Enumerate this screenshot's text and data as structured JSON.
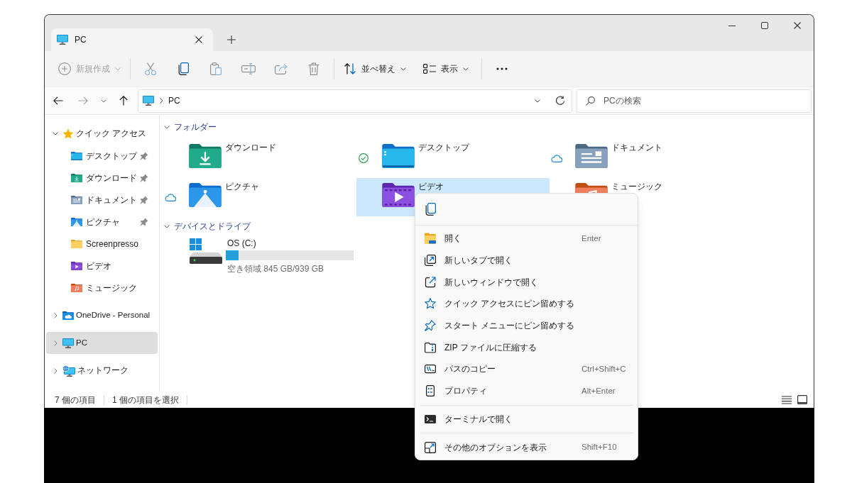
{
  "tabs": [
    {
      "label": "PC",
      "selected": true
    }
  ],
  "toolbar": {
    "new": {
      "label": "新規作成",
      "disabled": true
    },
    "actions": [
      {
        "kind": "cut",
        "disabled": true
      },
      {
        "kind": "copy",
        "disabled": false
      },
      {
        "kind": "paste",
        "disabled": true
      },
      {
        "kind": "rename",
        "disabled": true
      },
      {
        "kind": "share",
        "disabled": true
      },
      {
        "kind": "delete",
        "disabled": true
      }
    ],
    "sort": {
      "label": "並べ替え"
    },
    "view": {
      "label": "表示"
    }
  },
  "navigation": {
    "back": {
      "disabled": false
    },
    "forward": {
      "disabled": true
    },
    "up": {
      "disabled": false
    }
  },
  "address_bar": {
    "path": [
      {
        "kind": "pc",
        "label": "PC"
      }
    ]
  },
  "search": {
    "placeholder": "PCの検索"
  },
  "sidebar": {
    "items": [
      {
        "kind": "quickaccess",
        "label": "クイック アクセス",
        "expanded": true,
        "selected": false,
        "children": [
          {
            "kind": "desktop",
            "label": "デスクトップ",
            "pinned": true,
            "selected": false
          },
          {
            "kind": "downloads",
            "label": "ダウンロード",
            "pinned": true,
            "selected": false
          },
          {
            "kind": "documents",
            "label": "ドキュメント",
            "pinned": true,
            "selected": false
          },
          {
            "kind": "pictures",
            "label": "ピクチャ",
            "pinned": true,
            "selected": false
          },
          {
            "kind": "folder",
            "label": "Screenpresso",
            "pinned": false,
            "selected": false
          },
          {
            "kind": "videos",
            "label": "ビデオ",
            "pinned": false,
            "selected": false
          },
          {
            "kind": "music",
            "label": "ミュージック",
            "pinned": false,
            "selected": false
          }
        ]
      },
      {
        "kind": "onedrive",
        "label": "OneDrive - Personal",
        "expanded": false,
        "selected": false
      },
      {
        "kind": "pc",
        "label": "PC",
        "expanded": false,
        "selected": true
      },
      {
        "kind": "network",
        "label": "ネットワーク",
        "expanded": false,
        "selected": false
      }
    ]
  },
  "sections": [
    {
      "title": "フォルダー",
      "expanded": true,
      "folders": [
        {
          "kind": "downloads",
          "name": "ダウンロード",
          "synced": false,
          "online_only": false,
          "selected": false
        },
        {
          "kind": "desktop",
          "name": "デスクトップ",
          "synced": true,
          "online_only": false,
          "selected": false
        },
        {
          "kind": "documents",
          "name": "ドキュメント",
          "synced": false,
          "online_only": true,
          "selected": false
        },
        {
          "kind": "pictures",
          "name": "ピクチャ",
          "synced": false,
          "online_only": true,
          "selected": false
        },
        {
          "kind": "videos",
          "name": "ビデオ",
          "synced": false,
          "online_only": false,
          "selected": true
        },
        {
          "kind": "music",
          "name": "ミュージック",
          "synced": false,
          "online_only": false,
          "selected": false
        }
      ]
    },
    {
      "title": "デバイスとドライブ",
      "expanded": true,
      "drives": [
        {
          "name": "OS (C:)",
          "level": 0.1,
          "free": "空き領域 845 GB/939 GB"
        }
      ]
    }
  ],
  "status_bar": {
    "item_count": "7 個の項目",
    "selection": "1 個の項目を選択",
    "views": [
      {
        "kind": "details",
        "selected": false
      },
      {
        "kind": "tiles",
        "selected": false
      }
    ]
  },
  "context_menu": {
    "quick_actions": [
      {
        "kind": "copy"
      }
    ],
    "items": [
      {
        "kind": "open",
        "label": "開く",
        "shortcut": "Enter"
      },
      {
        "kind": "newtab",
        "label": "新しいタブで開く"
      },
      {
        "kind": "newwindow",
        "label": "新しいウィンドウで開く"
      },
      {
        "kind": "pinquick",
        "label": "クイック アクセスにピン留めする"
      },
      {
        "kind": "pinstart",
        "label": "スタート メニューにピン留めする"
      },
      {
        "kind": "zip",
        "label": "ZIP ファイルに圧縮する"
      },
      {
        "kind": "copypath",
        "label": "パスのコピー",
        "shortcut": "Ctrl+Shift+C"
      },
      {
        "kind": "properties",
        "label": "プロパティ",
        "shortcut": "Alt+Enter"
      },
      {
        "kind": "separator"
      },
      {
        "kind": "terminal",
        "label": "ターミナルで開く"
      },
      {
        "kind": "separator"
      },
      {
        "kind": "moreoptions",
        "label": "その他のオプションを表示",
        "shortcut": "Shift+F10"
      }
    ]
  }
}
